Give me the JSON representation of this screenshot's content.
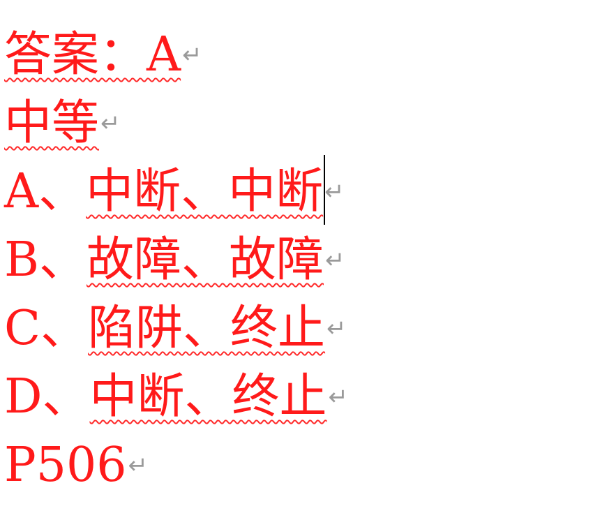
{
  "document": {
    "answer_line": "答案：A",
    "difficulty": "中等",
    "options": [
      {
        "prefix": "A、",
        "text": "中断、中断"
      },
      {
        "prefix": "B、",
        "text": "故障、故障"
      },
      {
        "prefix": "C、",
        "text": "陷阱、终止"
      },
      {
        "prefix": "D、",
        "text": "中断、终止"
      }
    ],
    "page_ref": "P506",
    "paragraph_mark": "↵"
  },
  "colors": {
    "text": "#ff1a1a",
    "squiggle": "#ff2a2a",
    "paragraph_mark": "#9a9a9a",
    "caret": "#000000"
  }
}
